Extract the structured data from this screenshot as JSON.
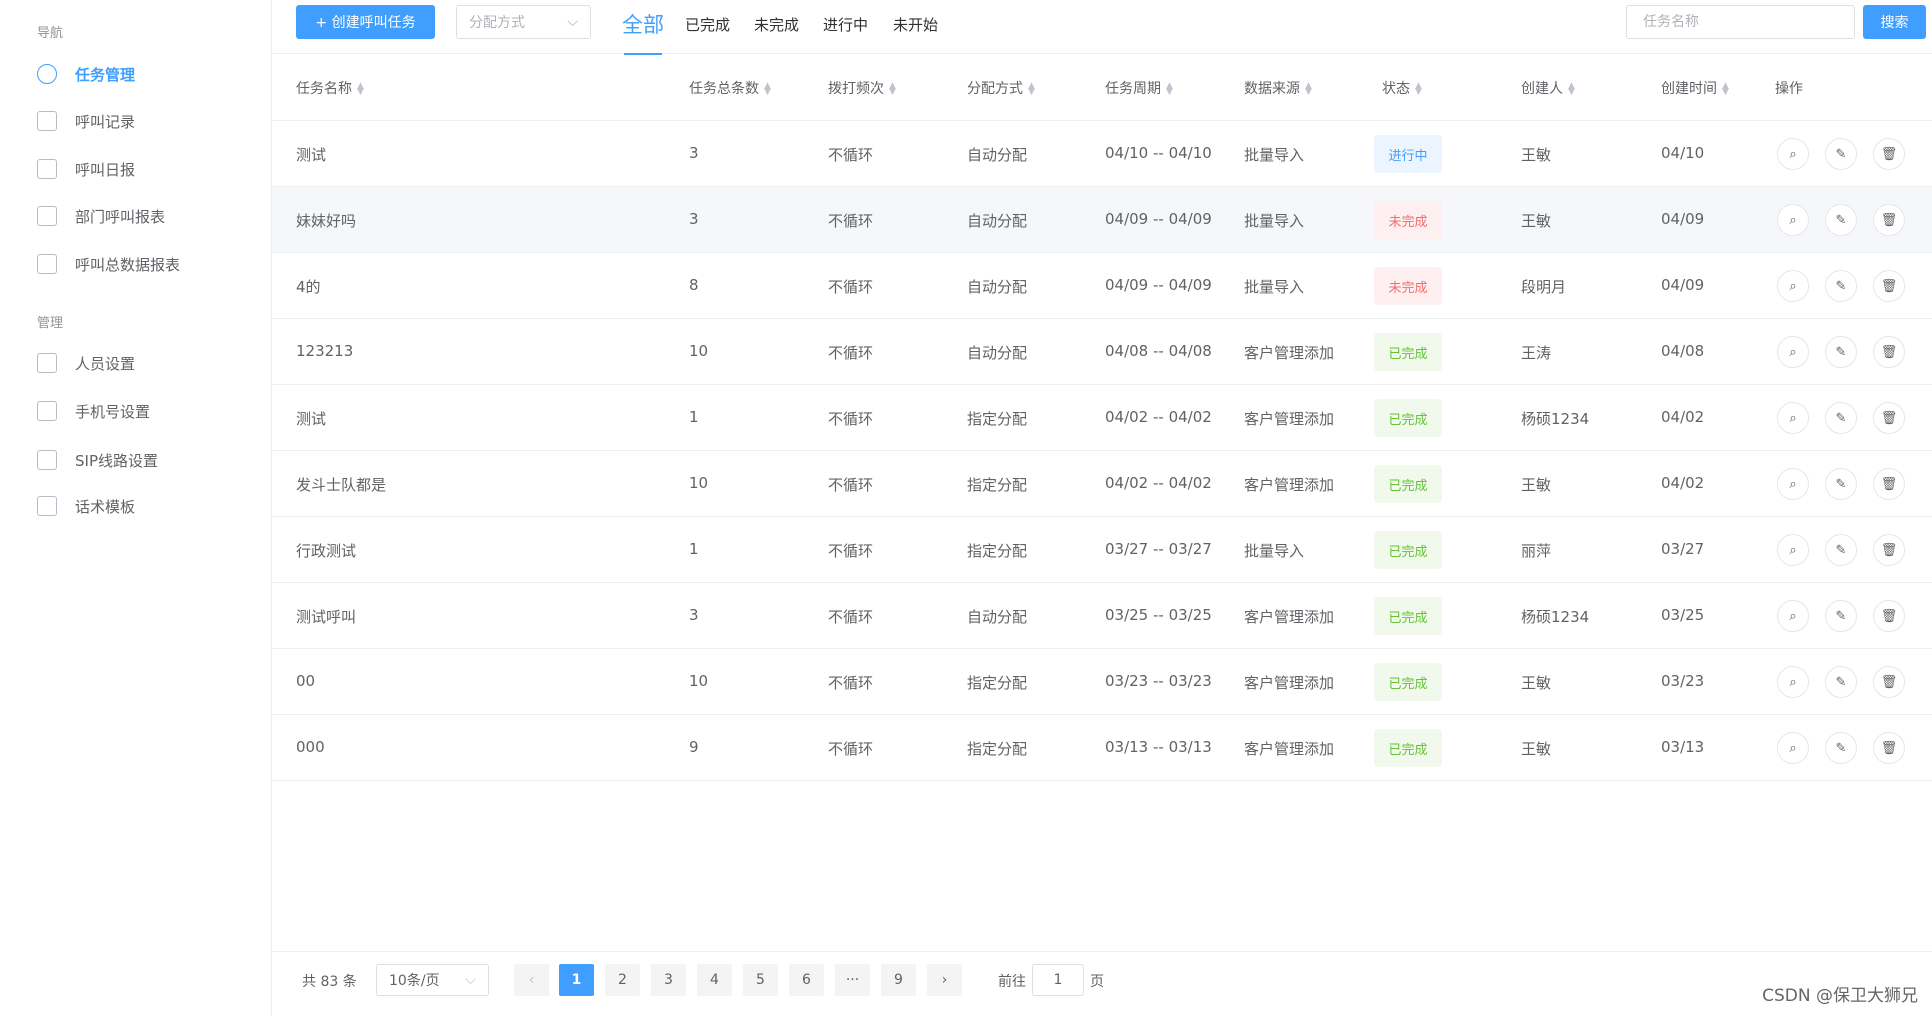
{
  "sidebar": {
    "section_nav": "导航",
    "nav_items": [
      {
        "label": "任务管理",
        "icon": "list-circle-icon",
        "active": true
      },
      {
        "label": "呼叫记录",
        "icon": "record-icon"
      },
      {
        "label": "呼叫日报",
        "icon": "chart-icon"
      },
      {
        "label": "部门呼叫报表",
        "icon": "calendar-icon"
      },
      {
        "label": "呼叫总数据报表",
        "icon": "report-icon"
      }
    ],
    "section_manage": "管理",
    "manage_items": [
      {
        "label": "人员设置",
        "icon": "users-icon"
      },
      {
        "label": "手机号设置",
        "icon": "phone-icon"
      },
      {
        "label": "SIP线路设置",
        "icon": "phone-line-icon"
      },
      {
        "label": "话术模板",
        "icon": "gear-icon"
      }
    ]
  },
  "toolbar": {
    "create_label": "+ 创建呼叫任务",
    "alloc_placeholder": "分配方式",
    "tabs": [
      "全部",
      "已完成",
      "未完成",
      "进行中",
      "未开始"
    ],
    "search_placeholder": "任务名称",
    "search_label": "搜索"
  },
  "table": {
    "headers": [
      "任务名称",
      "任务总条数",
      "拨打频次",
      "分配方式",
      "任务周期",
      "数据来源",
      "状态",
      "创建人",
      "创建时间",
      "操作"
    ],
    "rows": [
      [
        "测试",
        "3",
        "不循环",
        "自动分配",
        "04/10 -- 04/10",
        "批量导入",
        "进行中",
        "王敏",
        "04/10"
      ],
      [
        "妹妹好吗",
        "3",
        "不循环",
        "自动分配",
        "04/09 -- 04/09",
        "批量导入",
        "未完成",
        "王敏",
        "04/09"
      ],
      [
        "4的",
        "8",
        "不循环",
        "自动分配",
        "04/09 -- 04/09",
        "批量导入",
        "未完成",
        "段明月",
        "04/09"
      ],
      [
        "123213",
        "10",
        "不循环",
        "自动分配",
        "04/08 -- 04/08",
        "客户管理添加",
        "已完成",
        "王涛",
        "04/08"
      ],
      [
        "测试",
        "1",
        "不循环",
        "指定分配",
        "04/02 -- 04/02",
        "客户管理添加",
        "已完成",
        "杨硕1234",
        "04/02"
      ],
      [
        "发斗士队都是",
        "10",
        "不循环",
        "指定分配",
        "04/02 -- 04/02",
        "客户管理添加",
        "已完成",
        "王敏",
        "04/02"
      ],
      [
        "行政测试",
        "1",
        "不循环",
        "指定分配",
        "03/27 -- 03/27",
        "批量导入",
        "已完成",
        "丽萍",
        "03/27"
      ],
      [
        "测试呼叫",
        "3",
        "不循环",
        "自动分配",
        "03/25 -- 03/25",
        "客户管理添加",
        "已完成",
        "杨硕1234",
        "03/25"
      ],
      [
        "00",
        "10",
        "不循环",
        "指定分配",
        "03/23 -- 03/23",
        "客户管理添加",
        "已完成",
        "王敏",
        "03/23"
      ],
      [
        "000",
        "9",
        "不循环",
        "指定分配",
        "03/13 -- 03/13",
        "客户管理添加",
        "已完成",
        "王敏",
        "03/13"
      ]
    ],
    "status_colors": {
      "进行中": {
        "bg": "#ecf5ff",
        "fg": "#409eff"
      },
      "未完成": {
        "bg": "#fef0f0",
        "fg": "#f56c6c"
      },
      "已完成": {
        "bg": "#f0f9eb",
        "fg": "#67c23a"
      }
    }
  },
  "pagination": {
    "total": "共 83 条",
    "page_size": "10条/页",
    "pages": [
      "1",
      "2",
      "3",
      "4",
      "5",
      "6",
      "···",
      "9"
    ],
    "current": "1",
    "goto_label": "前往",
    "goto_value": "1",
    "page_unit": "页"
  },
  "watermark": "CSDN @保卫大狮兄"
}
